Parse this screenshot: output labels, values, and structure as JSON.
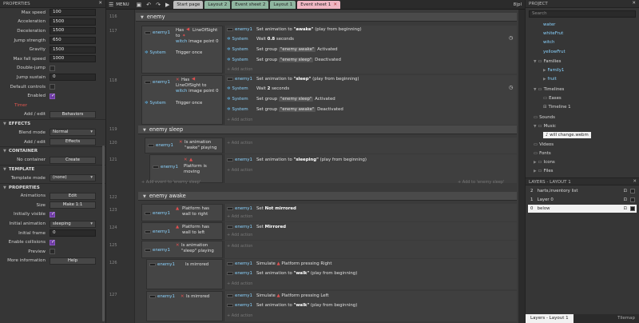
{
  "left_panel": {
    "title": "PROPERTIES",
    "rows": [
      {
        "label": "Max speed",
        "value": "100",
        "kind": "input"
      },
      {
        "label": "Acceleration",
        "value": "1500",
        "kind": "input"
      },
      {
        "label": "Deceleration",
        "value": "1500",
        "kind": "input"
      },
      {
        "label": "Jump strength",
        "value": "650",
        "kind": "input"
      },
      {
        "label": "Gravity",
        "value": "1500",
        "kind": "input"
      },
      {
        "label": "Max fall speed",
        "value": "1000",
        "kind": "input"
      },
      {
        "label": "Double-jump",
        "value": "",
        "kind": "check"
      },
      {
        "label": "Jump sustain",
        "value": "0",
        "kind": "input"
      },
      {
        "label": "Default controls",
        "value": "",
        "kind": "check"
      },
      {
        "label": "Enabled",
        "value": "",
        "kind": "check-on"
      }
    ],
    "timer_label": "Timer",
    "add_edit_label": "Add / edit",
    "behaviors_btn": "Behaviors",
    "effects_section": "EFFECTS",
    "blend_mode_label": "Blend mode",
    "blend_mode_value": "Normal",
    "effects_add_label": "Add / edit",
    "effects_btn": "Effects",
    "container_section": "CONTAINER",
    "no_container_label": "No container",
    "create_btn": "Create",
    "template_section": "TEMPLATE",
    "template_mode_label": "Template mode",
    "template_mode_value": "(none)",
    "properties_section": "PROPERTIES",
    "props": [
      {
        "label": "Animations",
        "value": "Edit",
        "kind": "btn"
      },
      {
        "label": "Size",
        "value": "Make 1:1",
        "kind": "btn"
      },
      {
        "label": "Initially visible",
        "value": "",
        "kind": "check-on"
      },
      {
        "label": "Initial animation",
        "value": "sleeping",
        "kind": "select"
      },
      {
        "label": "Initial frame",
        "value": "0",
        "kind": "input"
      },
      {
        "label": "Enable collisions",
        "value": "",
        "kind": "check-on"
      },
      {
        "label": "Preview",
        "value": "",
        "kind": "check"
      },
      {
        "label": "More information",
        "value": "Help",
        "kind": "btn"
      }
    ]
  },
  "topbar": {
    "menu": "MENU",
    "tabs": [
      "Start page",
      "Layout 2",
      "Event sheet 2",
      "Layout 1",
      "Event sheet 1"
    ],
    "right": "8|pl"
  },
  "sheet": {
    "group_enemy": "enemy",
    "group_sleep": "enemy sleep",
    "group_awake": "enemy awake",
    "line_numbers": [
      "116",
      "117",
      "118",
      "119",
      "120",
      "121",
      "122",
      "123",
      "124",
      "125",
      "126",
      "127"
    ],
    "ev117": {
      "c1_obj": "enemy1",
      "c1_text_a": "Has",
      "c1_text_b": "LineOfSight",
      "c1_text_c": "to",
      "c1_link": "witch",
      "c1_text_d": "image point 0",
      "c2_obj": "System",
      "c2_text": "Trigger once",
      "actions": [
        {
          "obj": "enemy1",
          "text": "Set animation to ",
          "bold": "\"awake\"",
          "tail": " (play from beginning)"
        },
        {
          "obj": "System",
          "text": "Wait ",
          "bold": "0.8",
          "tail": " seconds"
        },
        {
          "obj": "System",
          "text": "Set group ",
          "tag": "\"enemy awake\"",
          "tail": " Activated"
        },
        {
          "obj": "System",
          "text": "Set group ",
          "tag": "\"enemy sleep\"",
          "tail": " Deactivated"
        }
      ],
      "add_action": "Add action"
    },
    "ev118": {
      "c1_obj": "enemy1",
      "c1_text_a": "Has",
      "c1_text_b": "LineOfSight to",
      "c1_link": "witch",
      "c1_text_d": "image point 0",
      "c2_obj": "System",
      "c2_text": "Trigger once",
      "actions": [
        {
          "obj": "enemy1",
          "text": "Set animation to ",
          "bold": "\"sleep\"",
          "tail": " (play from beginning)"
        },
        {
          "obj": "System",
          "text": "Wait ",
          "bold": "2",
          "tail": " seconds"
        },
        {
          "obj": "System",
          "text": "Set group ",
          "tag": "\"enemy sleep\"",
          "tail": " Activated"
        },
        {
          "obj": "System",
          "text": "Set group ",
          "tag": "\"enemy awake\"",
          "tail": " Deactivated"
        }
      ],
      "add_action": "Add action"
    },
    "ev120": {
      "obj": "enemy1",
      "text": "Is animation \"wake\" playing",
      "add_action": "Add action"
    },
    "ev121": {
      "obj": "enemy1",
      "text": "Platform is moving",
      "action_obj": "enemy1",
      "action_text": "Set animation to ",
      "action_bold": "\"sleeping\"",
      "action_tail": " (play from beginning)",
      "add_action": "Add action"
    },
    "add_event_sleep": "Add event to 'enemy sleep'",
    "add_event_sleep_right": "Add to 'enemy sleep'",
    "ev123": {
      "obj": "enemy1",
      "text": "Platform has wall to right",
      "action_obj": "enemy1",
      "action_text": "Set ",
      "action_bold": "Not mirrored",
      "add_action": "Add action"
    },
    "ev124": {
      "obj": "enemy1",
      "text": "Platform has wall to left",
      "action_obj": "enemy1",
      "action_text": "Set ",
      "action_bold": "Mirrored",
      "add_action": "Add action"
    },
    "ev125": {
      "obj": "enemy1",
      "text": "Is animation \"sleep\" playing",
      "add_action": "Add action"
    },
    "ev126": {
      "obj": "enemy1",
      "text": "Is mirrored",
      "actions": [
        {
          "obj": "enemy1",
          "text": "Simulate ",
          "bold": "Platform pressing Right"
        },
        {
          "obj": "enemy1",
          "text": "Set animation to ",
          "bold": "\"walk\"",
          "tail": " (play from beginning)"
        }
      ],
      "add_action": "Add action"
    },
    "ev127": {
      "obj": "enemy1",
      "text": "Is mirrored",
      "actions": [
        {
          "obj": "enemy1",
          "text": "Simulate ",
          "bold": "Platform pressing Left"
        },
        {
          "obj": "enemy1",
          "text": "Set animation to ",
          "bold": "\"walk\"",
          "tail": " (play from beginning)"
        }
      ],
      "add_action": "Add action"
    }
  },
  "right_panel": {
    "title": "PROJECT",
    "search_placeholder": "Search",
    "items": [
      {
        "label": "water",
        "blue": true
      },
      {
        "label": "whiteFrut",
        "blue": true
      },
      {
        "label": "witch",
        "blue": true
      },
      {
        "label": "yellowFrut",
        "blue": true
      },
      {
        "label": "Families",
        "blue": false
      },
      {
        "label": "Family1",
        "blue": true
      },
      {
        "label": "fruit",
        "blue": true
      },
      {
        "label": "Timelines",
        "blue": false
      },
      {
        "label": "Eases",
        "blue": false
      },
      {
        "label": "Timeline 1",
        "blue": false
      },
      {
        "label": "Sounds",
        "blue": false
      },
      {
        "label": "Music",
        "blue": false
      },
      {
        "label": "will change.webm",
        "blue": false
      },
      {
        "label": "Videos",
        "blue": false
      },
      {
        "label": "Fonts",
        "blue": false
      },
      {
        "label": "Icons",
        "blue": false
      },
      {
        "label": "Files",
        "blue": false
      }
    ],
    "layers_title": "LAYERS - LAYOUT 1",
    "layers": [
      {
        "num": "2",
        "name": "harts,inventory list"
      },
      {
        "num": "1",
        "name": "Layer 0"
      },
      {
        "num": "0",
        "name": "below"
      }
    ],
    "bottom_tabs": [
      "Layers - Layout 1",
      "Tilemap"
    ]
  }
}
